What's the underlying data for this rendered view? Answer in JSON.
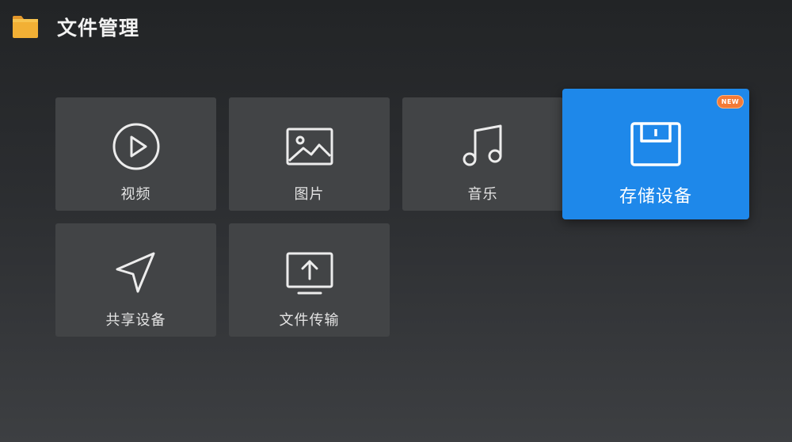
{
  "header": {
    "title": "文件管理",
    "icon": "folder-icon",
    "icon_color": "#f2b035"
  },
  "tiles": [
    {
      "label": "视频",
      "icon": "play-circle-icon"
    },
    {
      "label": "图片",
      "icon": "image-icon"
    },
    {
      "label": "音乐",
      "icon": "music-note-icon"
    },
    {
      "label": "存储设备",
      "icon": "floppy-disk-icon",
      "badge": "NEW",
      "focused": true
    },
    {
      "label": "共享设备",
      "icon": "send-arrow-icon"
    },
    {
      "label": "文件传输",
      "icon": "upload-screen-icon"
    }
  ],
  "colors": {
    "background": "#2c2e31",
    "tile": "#424446",
    "focused_tile": "#1e88ea",
    "badge": "#f47a36"
  }
}
